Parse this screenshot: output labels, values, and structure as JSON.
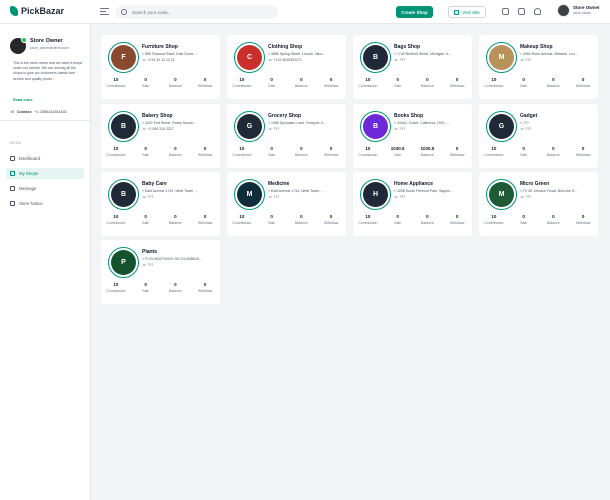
{
  "header": {
    "brand": "PickBazar",
    "search_placeholder": "Search your route...",
    "create_shop_label": "Create Shop",
    "visit_site_label": "Visit Site",
    "profile_name": "Store Owner",
    "profile_role": "store owner"
  },
  "sidebar": {
    "owner_name": "Store Owner",
    "owner_email": "store_owner@demo.com",
    "bio": "This is the store owner and we have 6 shops under our banner. We are running all the shops to give our customers hassle-free service and quality produ...",
    "read_more": "Read more",
    "contact_label": "Contact:",
    "contact_value": "+1 2365141641631",
    "menu_label": "MENU",
    "nav": [
      {
        "label": "Dashboard"
      },
      {
        "label": "My Shops"
      },
      {
        "label": "Message"
      },
      {
        "label": "Store Notice"
      }
    ]
  },
  "colors": {
    "accent": "#019376"
  },
  "stat_labels": [
    "Commission",
    "Sale",
    "Balance",
    "Withdraw"
  ],
  "shops": [
    {
      "name": "Furniture Shop",
      "address": "588 Finwood Road, East Dover, ...",
      "phone": "+219 42 13 13 21",
      "stats": [
        "10",
        "0",
        "0",
        "0"
      ],
      "logo_color": "#8a4a2f"
    },
    {
      "name": "Clothing Shop",
      "address": "4885 Spring Street, Lincoln, Illino...",
      "phone": "+212-9618352271",
      "stats": [
        "10",
        "0",
        "0",
        "0"
      ],
      "logo_color": "#c9302c"
    },
    {
      "name": "Bags Shop",
      "address": "1740 Bedford Street, Michigan, A...",
      "phone": "???",
      "stats": [
        "10",
        "0",
        "0",
        "0"
      ],
      "logo_color": "#1f2937"
    },
    {
      "name": "Makeup Shop",
      "address": "2960 Rose Avenue, Metairie, Lou...",
      "phone": "???",
      "stats": [
        "10",
        "0",
        "0",
        "0"
      ],
      "logo_color": "#b7925a"
    },
    {
      "name": "Bakery Shop",
      "address": "4422 Fort Street, Rocky Mount,...",
      "phone": "+1 090 310 2317",
      "stats": [
        "10",
        "0",
        "0",
        "0"
      ],
      "logo_color": "#1f2937"
    },
    {
      "name": "Grocery Shop",
      "address": "1986 Spinnaker Lane, Freeport, Il...",
      "phone": "???",
      "stats": [
        "10",
        "0",
        "0",
        "0"
      ],
      "logo_color": "#1f2937"
    },
    {
      "name": "Books Shop",
      "address": "44444, Zurich, California, 2021, ...",
      "phone": "???",
      "stats": [
        "10",
        "1030.5",
        "1030.5",
        "0"
      ],
      "logo_color": "#6d28d9"
    },
    {
      "name": "Gadget",
      "address": "???",
      "phone": "???",
      "stats": [
        "10",
        "0",
        "0",
        "0"
      ],
      "logo_color": "#1f2937"
    },
    {
      "name": "Baby Care",
      "address": "East Avenue 1743, West Tower, ...",
      "phone": "???",
      "stats": [
        "10",
        "0",
        "0",
        "0"
      ],
      "logo_color": "#1f2937"
    },
    {
      "name": "Medicine",
      "address": "East Avenue 1743, West Tower, ...",
      "phone": "???",
      "stats": [
        "10",
        "0",
        "0",
        "0"
      ],
      "logo_color": "#0f2d3a"
    },
    {
      "name": "Home Appliance",
      "address": "4258 South Fremont Park, Sappin...",
      "phone": "???",
      "stats": [
        "10",
        "0",
        "0",
        "0"
      ],
      "logo_color": "#1f2937"
    },
    {
      "name": "Micro Green",
      "address": "TX 50 Johnson Road, New Are S...",
      "phone": "???",
      "stats": [
        "10",
        "0",
        "0",
        "0"
      ],
      "logo_color": "#1f5a36"
    },
    {
      "name": "Plants",
      "address": "FLYN BOOTWICK 95 COLUMBUS...",
      "phone": "???",
      "stats": [
        "10",
        "0",
        "0",
        "0"
      ],
      "logo_color": "#14532d"
    }
  ]
}
